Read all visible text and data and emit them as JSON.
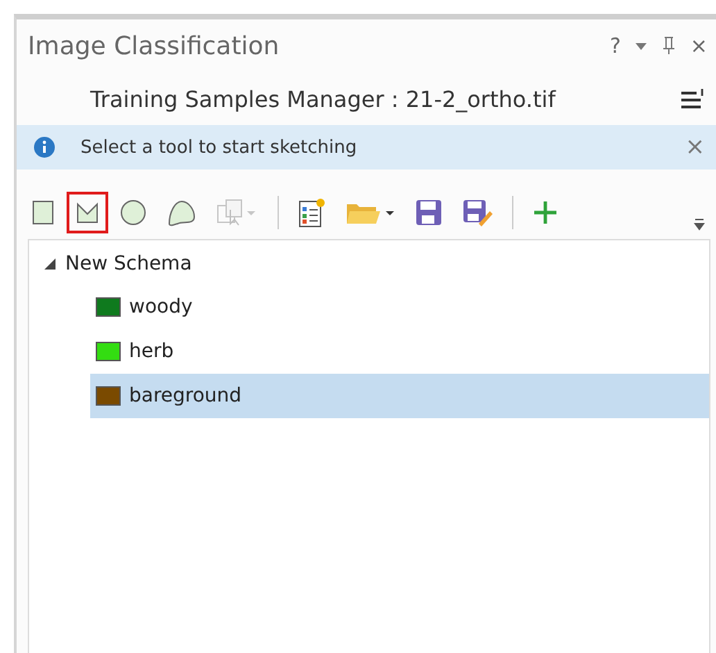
{
  "pane": {
    "title": "Image Classification",
    "help": "?",
    "close": "×"
  },
  "manager": {
    "title": "Training Samples Manager : 21-2_ortho.tif"
  },
  "info_bar": {
    "message": "Select a tool to start sketching",
    "close": "×"
  },
  "toolbar": {
    "groups": [
      [
        {
          "kind": "rectangle",
          "selected": false,
          "disabled": false
        },
        {
          "kind": "polygon",
          "selected": true,
          "disabled": false
        },
        {
          "kind": "circle",
          "selected": false,
          "disabled": false
        },
        {
          "kind": "freehand",
          "selected": false,
          "disabled": false
        },
        {
          "kind": "select",
          "selected": false,
          "disabled": true
        }
      ],
      [
        {
          "kind": "properties",
          "selected": false,
          "disabled": false
        },
        {
          "kind": "open",
          "selected": false,
          "disabled": false
        },
        {
          "kind": "save",
          "selected": false,
          "disabled": false
        },
        {
          "kind": "save-as",
          "selected": false,
          "disabled": false
        }
      ],
      [
        {
          "kind": "add",
          "selected": false,
          "disabled": false
        }
      ]
    ]
  },
  "tree": [
    {
      "label": "New Schema",
      "expanded": true,
      "children": [
        {
          "label": "woody",
          "color": "#0f7a1e",
          "selected": false
        },
        {
          "label": "herb",
          "color": "#33dd11",
          "selected": false
        },
        {
          "label": "bareground",
          "color": "#7a4a00",
          "selected": true
        }
      ]
    }
  ]
}
